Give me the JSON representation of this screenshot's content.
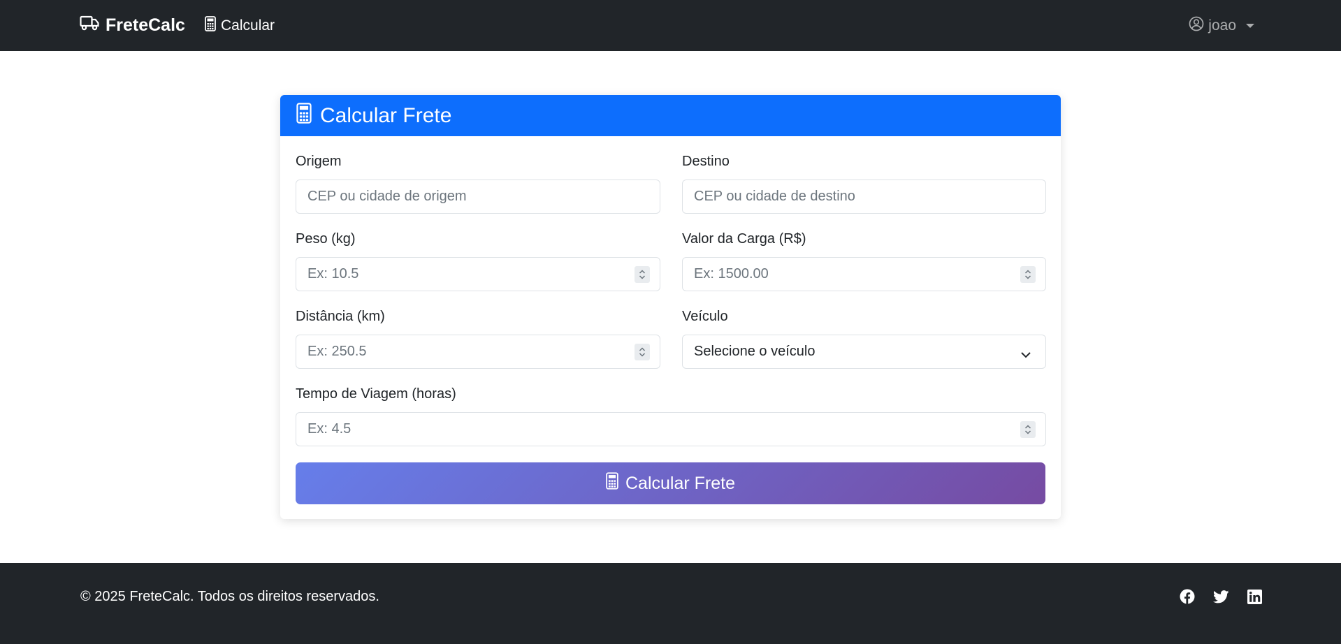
{
  "navbar": {
    "brand": "FreteCalc",
    "brand_icon": "truck-icon",
    "nav_link": "Calcular",
    "nav_icon": "calculator-icon",
    "user": "joao",
    "user_icon": "person-circle-icon"
  },
  "card": {
    "title": "Calcular Frete",
    "title_icon": "calculator-icon",
    "fields": {
      "origem": {
        "label": "Origem",
        "placeholder": "CEP ou cidade de origem"
      },
      "destino": {
        "label": "Destino",
        "placeholder": "CEP ou cidade de destino"
      },
      "peso": {
        "label": "Peso (kg)",
        "placeholder": "Ex: 10.5"
      },
      "valor": {
        "label": "Valor da Carga (R$)",
        "placeholder": "Ex: 1500.00"
      },
      "distancia": {
        "label": "Distância (km)",
        "placeholder": "Ex: 250.5"
      },
      "veiculo": {
        "label": "Veículo",
        "selected": "Selecione o veículo"
      },
      "tempo": {
        "label": "Tempo de Viagem (horas)",
        "placeholder": "Ex: 4.5"
      }
    },
    "submit_label": "Calcular Frete"
  },
  "footer": {
    "copyright": "© 2025 FreteCalc. Todos os direitos reservados.",
    "social_icons": [
      "facebook-icon",
      "twitter-icon",
      "linkedin-icon"
    ]
  },
  "colors": {
    "navbar_bg": "#212529",
    "header_bg": "#0d6efd",
    "button_gradient_start": "#667eea",
    "button_gradient_end": "#764ba2"
  }
}
